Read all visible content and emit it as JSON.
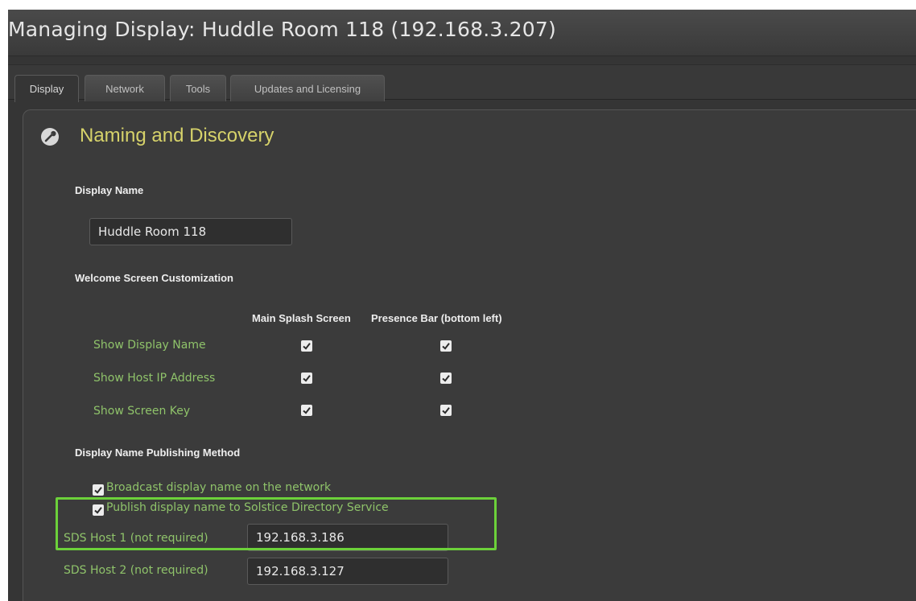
{
  "window": {
    "title": "Managing Display: Huddle Room 118 (192.168.3.207)"
  },
  "tabs": [
    {
      "label": "Display",
      "active": true
    },
    {
      "label": "Network",
      "active": false
    },
    {
      "label": "Tools",
      "active": false
    },
    {
      "label": "Updates and Licensing",
      "active": false
    }
  ],
  "section": {
    "icon": "wrench-icon",
    "title": "Naming and Discovery"
  },
  "display_name": {
    "label": "Display Name",
    "value": "Huddle Room 118"
  },
  "welcome": {
    "label": "Welcome Screen Customization",
    "columns": [
      "Main Splash Screen",
      "Presence Bar (bottom left)"
    ],
    "rows": [
      {
        "label": "Show Display Name",
        "main_splash": true,
        "presence_bar": true
      },
      {
        "label": "Show Host IP Address",
        "main_splash": true,
        "presence_bar": true
      },
      {
        "label": "Show Screen Key",
        "main_splash": true,
        "presence_bar": true
      }
    ]
  },
  "publishing": {
    "label": "Display Name Publishing Method",
    "options": [
      {
        "label": "Broadcast display name on the network",
        "checked": true
      },
      {
        "label": "Publish display name to Solstice Directory Service",
        "checked": true
      }
    ],
    "sds_hosts": [
      {
        "label": "SDS Host 1 (not required)",
        "value": "192.168.3.186"
      },
      {
        "label": "SDS Host 2 (not required)",
        "value": "192.168.3.127"
      }
    ]
  },
  "colors": {
    "accent_title": "#d6d26a",
    "green_label": "#8fc36a",
    "highlight": "#6cd13a"
  }
}
